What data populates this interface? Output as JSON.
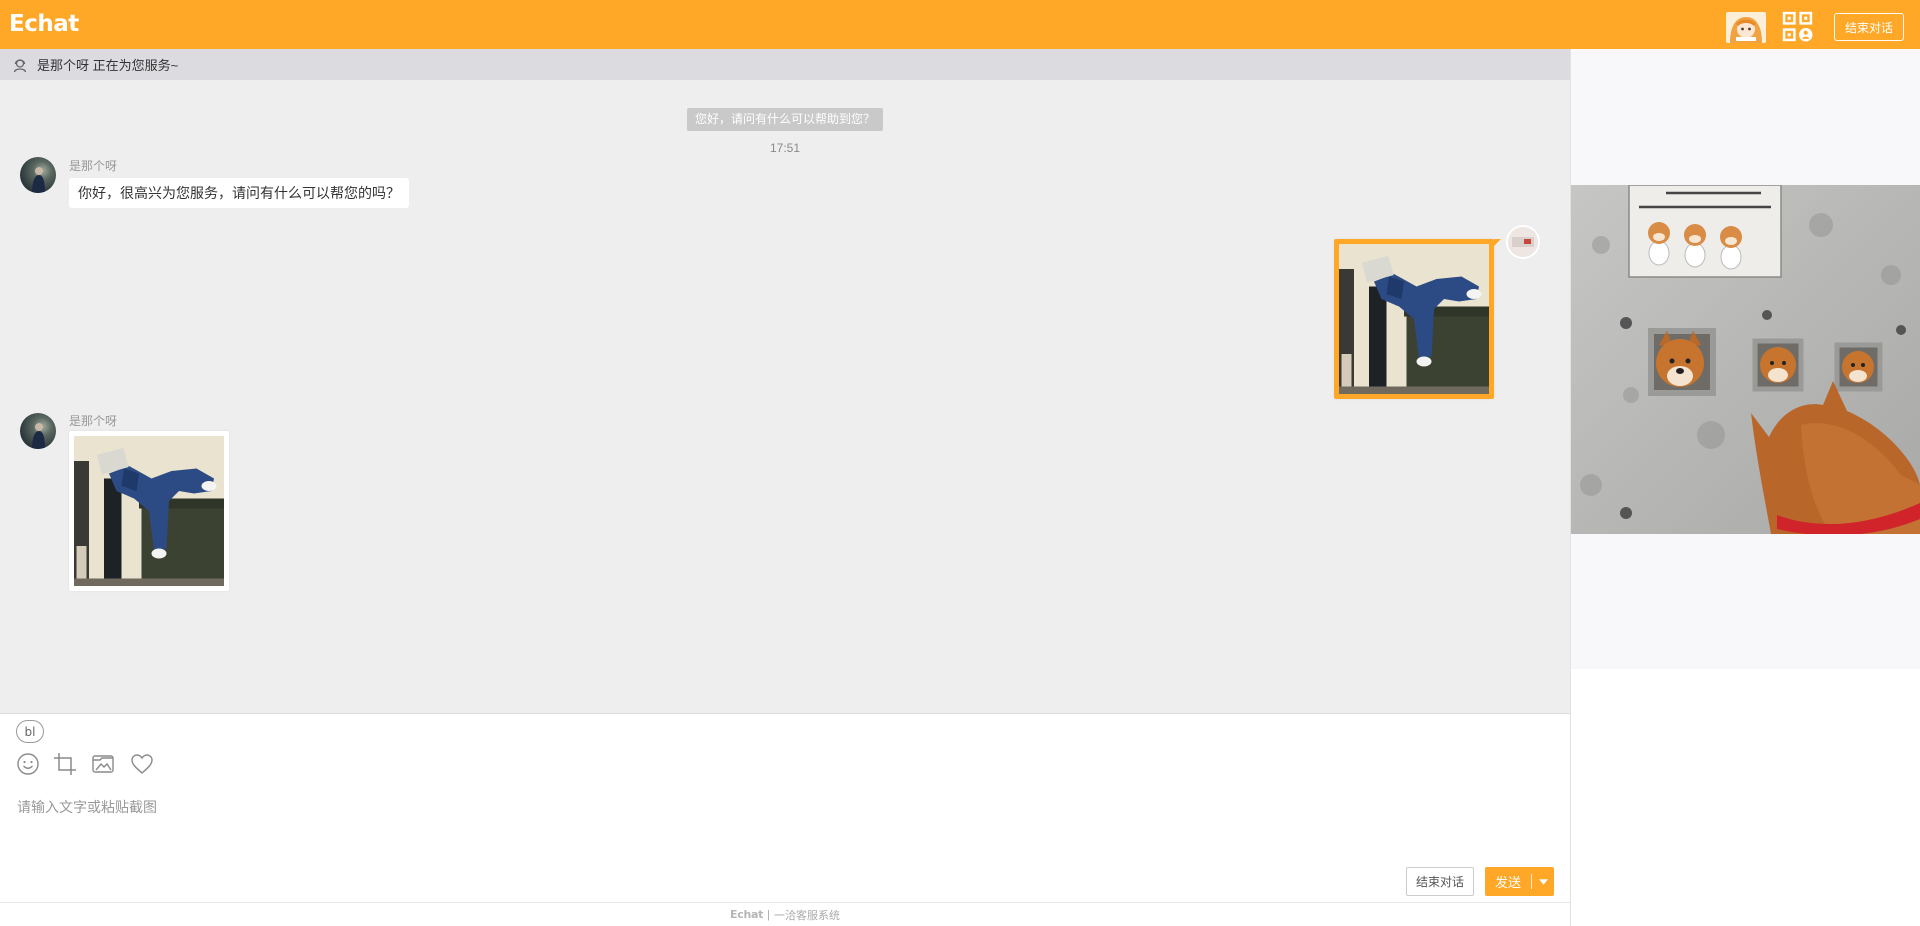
{
  "app": {
    "logo": "Echat"
  },
  "header": {
    "end_chat_label": "结束对话"
  },
  "status_bar": {
    "text": "是那个呀 正在为您服务~"
  },
  "chat": {
    "system_message": "您好，请问有什么可以帮助到您？",
    "timestamp": "17:51",
    "agent_messages": [
      {
        "name": "是那个呀",
        "text": "你好，很高兴为您服务，请问有什么可以帮您的吗？"
      },
      {
        "name": "是那个呀"
      }
    ]
  },
  "composer": {
    "format_toggle": "bl",
    "placeholder": "请输入文字或粘贴截图",
    "end_chat_label": "结束对话",
    "send_label": "发送"
  },
  "footer": {
    "brand": "Echat",
    "separator": "|",
    "text": "一洽客服系统"
  },
  "icons": {
    "status": "agent-headset-icon",
    "header": [
      "agent-profile-avatar",
      "qr-code-icon"
    ],
    "toolbar": [
      "emoji-icon",
      "crop-icon",
      "image-icon",
      "heart-icon"
    ],
    "send_menu": "caret-down-icon"
  },
  "colors": {
    "brand": "#FFA827",
    "chat_bg": "#EEEEEE",
    "status_bg": "#DCDCE0",
    "system_pill": "#C9C9C9",
    "panel_bg": "#F8F8FB"
  }
}
